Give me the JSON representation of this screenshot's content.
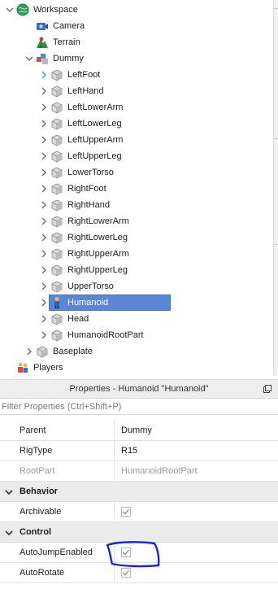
{
  "explorer": {
    "items": [
      {
        "label": "Workspace",
        "icon": "globe-icon",
        "depth": 0,
        "arrow": "expanded"
      },
      {
        "label": "Camera",
        "icon": "camera-icon",
        "depth": 1,
        "arrow": "none"
      },
      {
        "label": "Terrain",
        "icon": "terrain-icon",
        "depth": 1,
        "arrow": "none"
      },
      {
        "label": "Dummy",
        "icon": "model-icon",
        "depth": 1,
        "arrow": "expanded"
      },
      {
        "label": "LeftFoot",
        "icon": "part-icon",
        "depth": 2,
        "arrow": "collapsed-hover"
      },
      {
        "label": "LeftHand",
        "icon": "part-icon",
        "depth": 2,
        "arrow": "collapsed"
      },
      {
        "label": "LeftLowerArm",
        "icon": "part-icon",
        "depth": 2,
        "arrow": "collapsed"
      },
      {
        "label": "LeftLowerLeg",
        "icon": "part-icon",
        "depth": 2,
        "arrow": "collapsed"
      },
      {
        "label": "LeftUpperArm",
        "icon": "part-icon",
        "depth": 2,
        "arrow": "collapsed"
      },
      {
        "label": "LeftUpperLeg",
        "icon": "part-icon",
        "depth": 2,
        "arrow": "collapsed"
      },
      {
        "label": "LowerTorso",
        "icon": "part-icon",
        "depth": 2,
        "arrow": "collapsed"
      },
      {
        "label": "RightFoot",
        "icon": "part-icon",
        "depth": 2,
        "arrow": "collapsed"
      },
      {
        "label": "RightHand",
        "icon": "part-icon",
        "depth": 2,
        "arrow": "collapsed"
      },
      {
        "label": "RightLowerArm",
        "icon": "part-icon",
        "depth": 2,
        "arrow": "collapsed"
      },
      {
        "label": "RightLowerLeg",
        "icon": "part-icon",
        "depth": 2,
        "arrow": "collapsed"
      },
      {
        "label": "RightUpperArm",
        "icon": "part-icon",
        "depth": 2,
        "arrow": "collapsed"
      },
      {
        "label": "RightUpperLeg",
        "icon": "part-icon",
        "depth": 2,
        "arrow": "collapsed"
      },
      {
        "label": "UpperTorso",
        "icon": "part-icon",
        "depth": 2,
        "arrow": "collapsed"
      },
      {
        "label": "Humanoid",
        "icon": "humanoid-icon",
        "depth": 2,
        "arrow": "collapsed",
        "selected": true
      },
      {
        "label": "Head",
        "icon": "part-icon",
        "depth": 2,
        "arrow": "collapsed"
      },
      {
        "label": "HumanoidRootPart",
        "icon": "part-icon",
        "depth": 2,
        "arrow": "collapsed"
      },
      {
        "label": "Baseplate",
        "icon": "part-icon",
        "depth": 1,
        "arrow": "collapsed"
      },
      {
        "label": "Players",
        "icon": "players-icon",
        "depth": 0,
        "arrow": "none"
      }
    ]
  },
  "properties": {
    "title": "Properties - Humanoid \"Humanoid\"",
    "filter_placeholder": "Filter Properties (Ctrl+Shift+P)",
    "rows": [
      {
        "kind": "prop",
        "name": "Parent",
        "value": "Dummy"
      },
      {
        "kind": "prop",
        "name": "RigType",
        "value": "R15"
      },
      {
        "kind": "prop",
        "name": "RootPart",
        "value": "HumanoidRootPart",
        "disabled": true
      },
      {
        "kind": "category",
        "name": "Behavior"
      },
      {
        "kind": "prop",
        "name": "Archivable",
        "checkbox": true,
        "checked": true
      },
      {
        "kind": "category",
        "name": "Control"
      },
      {
        "kind": "prop",
        "name": "AutoJumpEnabled",
        "checkbox": true,
        "checked": true
      },
      {
        "kind": "prop",
        "name": "AutoRotate",
        "checkbox": true,
        "checked": true
      }
    ]
  },
  "colors": {
    "selection": "#5b86d6",
    "annotation": "#1a25d8",
    "hover_arrow": "#2a9be0"
  }
}
